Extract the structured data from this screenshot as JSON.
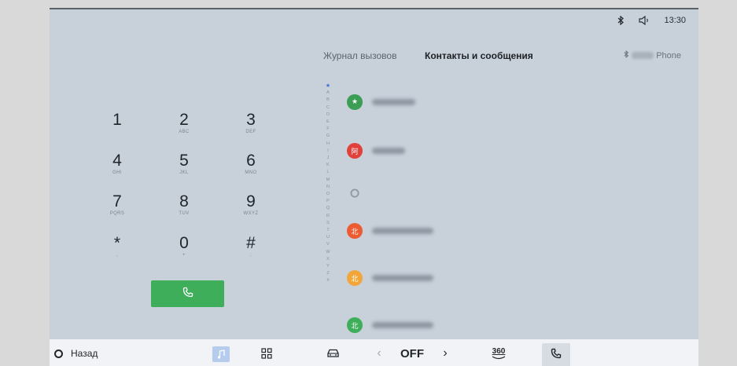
{
  "status_bar": {
    "time": "13:30",
    "icons": [
      "bluetooth-icon",
      "volume-icon"
    ]
  },
  "tabs": [
    {
      "label": "Журнал вызовов",
      "active": false
    },
    {
      "label": "Контакты и сообщения",
      "active": true
    }
  ],
  "connected_phone": {
    "name_suffix": "Phone",
    "icon": "bluetooth-icon"
  },
  "keypad": {
    "keys": [
      {
        "digit": "1",
        "letters": ""
      },
      {
        "digit": "2",
        "letters": "ABC"
      },
      {
        "digit": "3",
        "letters": "DEF"
      },
      {
        "digit": "4",
        "letters": "GHI"
      },
      {
        "digit": "5",
        "letters": "JKL"
      },
      {
        "digit": "6",
        "letters": "MNO"
      },
      {
        "digit": "7",
        "letters": "PQRS"
      },
      {
        "digit": "8",
        "letters": "TUV"
      },
      {
        "digit": "9",
        "letters": "WXYZ"
      },
      {
        "digit": "*",
        "letters": ","
      },
      {
        "digit": "0",
        "letters": "+"
      },
      {
        "digit": "#",
        "letters": ";"
      }
    ],
    "call_button_icon": "phone-icon"
  },
  "alphabet_index": [
    "★",
    "A",
    "B",
    "C",
    "D",
    "E",
    "F",
    "G",
    "H",
    "I",
    "J",
    "K",
    "L",
    "M",
    "N",
    "O",
    "P",
    "Q",
    "R",
    "S",
    "T",
    "U",
    "V",
    "W",
    "X",
    "Y",
    "Z",
    "#"
  ],
  "contacts": [
    {
      "avatar_text": "★",
      "avatar_color": "#3c9d55",
      "icon": "star-icon"
    },
    {
      "avatar_text": "阿",
      "avatar_color": "#e0413b",
      "icon": ""
    },
    {
      "avatar_text": "",
      "avatar_color": "#c8d0da",
      "icon": "placeholder-icon"
    },
    {
      "avatar_text": "北",
      "avatar_color": "#ec5b32",
      "icon": ""
    },
    {
      "avatar_text": "北",
      "avatar_color": "#f2a63a",
      "icon": ""
    },
    {
      "avatar_text": "北",
      "avatar_color": "#3fae5b",
      "icon": ""
    }
  ],
  "bottom_bar": {
    "back_label": "Назад",
    "climate_value": "OFF",
    "view_360_label": "360",
    "icons": [
      "circle-icon",
      "music-icon",
      "grid-icon",
      "car-icon",
      "chevron-left-icon",
      "chevron-right-icon",
      "camera-360-icon",
      "phone-icon"
    ]
  },
  "colors": {
    "screen_bg": "#c8d0da",
    "call_green": "#3fae5b",
    "bottom_bar_bg": "#f1f3f6"
  }
}
